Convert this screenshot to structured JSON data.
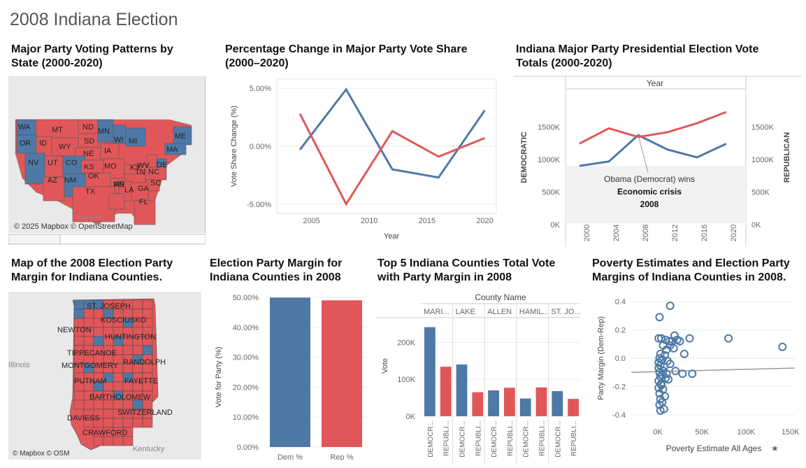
{
  "dashboard_title": "2008 Indiana Election",
  "colors": {
    "dem": "#4e79a7",
    "rep": "#e15759",
    "map_bg": "#e6e6e6",
    "trend": "#999999"
  },
  "panels": {
    "us_map": {
      "title_line1": "Major Party Voting Patterns by",
      "title_line2": "State (2000-2020)",
      "attribution": "© 2025 Mapbox © OpenStreetMap",
      "country_label": "Mexico",
      "states": [
        {
          "abbr": "WA",
          "party": "dem"
        },
        {
          "abbr": "OR",
          "party": "dem"
        },
        {
          "abbr": "MT",
          "party": "rep"
        },
        {
          "abbr": "ND",
          "party": "rep"
        },
        {
          "abbr": "MN",
          "party": "dem"
        },
        {
          "abbr": "ID",
          "party": "rep"
        },
        {
          "abbr": "SD",
          "party": "rep"
        },
        {
          "abbr": "WI",
          "party": "dem"
        },
        {
          "abbr": "MI",
          "party": "dem"
        },
        {
          "abbr": "WY",
          "party": "rep"
        },
        {
          "abbr": "NE",
          "party": "rep"
        },
        {
          "abbr": "IA",
          "party": "rep"
        },
        {
          "abbr": "NV",
          "party": "dem"
        },
        {
          "abbr": "UT",
          "party": "rep"
        },
        {
          "abbr": "CO",
          "party": "dem"
        },
        {
          "abbr": "MO",
          "party": "rep"
        },
        {
          "abbr": "KS",
          "party": "rep"
        },
        {
          "abbr": "KY",
          "party": "rep"
        },
        {
          "abbr": "WV",
          "party": "rep"
        },
        {
          "abbr": "DE",
          "party": "dem"
        },
        {
          "abbr": "AZ",
          "party": "rep"
        },
        {
          "abbr": "NM",
          "party": "dem"
        },
        {
          "abbr": "OK",
          "party": "rep"
        },
        {
          "abbr": "TN",
          "party": "rep"
        },
        {
          "abbr": "NC",
          "party": "rep"
        },
        {
          "abbr": "AR",
          "party": "rep"
        },
        {
          "abbr": "SC",
          "party": "rep"
        },
        {
          "abbr": "TX",
          "party": "rep"
        },
        {
          "abbr": "MS",
          "party": "rep"
        },
        {
          "abbr": "GA",
          "party": "rep"
        },
        {
          "abbr": "LA",
          "party": "rep"
        },
        {
          "abbr": "FL",
          "party": "rep"
        },
        {
          "abbr": "ME",
          "party": "dem"
        },
        {
          "abbr": "MA",
          "party": "dem"
        }
      ]
    },
    "pct_change": {
      "title_line1": "Percentage Change in Major Party Vote Share",
      "title_line2": "(2000–2020)"
    },
    "totals": {
      "title_line1": "Indiana Major Party Presidential Election Vote",
      "title_line2": "Totals (2000-2020)",
      "annotation_line1": "Obama (Democrat) wins",
      "annotation_line2": "Economic crisis",
      "annotation_line3": "2008"
    },
    "in_map": {
      "title_line1": "Map of the 2008 Election Party",
      "title_line2": "Margin for Indiana Counties.",
      "attribution": "© Mapbox © OSM",
      "region_labels": [
        "Illinois",
        "Kentucky"
      ],
      "county_labels": [
        "ST. JOSEPH",
        "KOSCIUSKO",
        "NEWTON",
        "HUNTINGTON",
        "TIPPECANOE",
        "MONTGOMERY",
        "RANDOLPH",
        "PUTNAM",
        "FAYETTE",
        "BARTHOLOMEW",
        "DAVIESS",
        "SWITZERLAND",
        "CRAWFORD"
      ]
    },
    "margin": {
      "title_line1": "Election Party Margin for",
      "title_line2": "Indiana Counties in 2008"
    },
    "top5": {
      "title_line1": "Top 5 Indiana Counties Total Vote",
      "title_line2": "with Party Margin in 2008"
    },
    "poverty": {
      "title_line1": "Poverty Estimates and Election Party",
      "title_line2": "Margins of Indiana Counties in 2008.",
      "pin_icon": "pin-icon"
    }
  },
  "chart_data": [
    {
      "type": "line",
      "x": [
        2004,
        2008,
        2012,
        2016,
        2020
      ],
      "series": [
        {
          "name": "Democratic",
          "values": [
            -0.3,
            4.9,
            -2.0,
            -2.7,
            3.1
          ]
        },
        {
          "name": "Republican",
          "values": [
            2.8,
            -5.0,
            1.3,
            -0.9,
            0.7
          ]
        }
      ],
      "xlabel": "Year",
      "ylabel": "Vote Share Change (%)",
      "xticks": [
        "2005",
        "2010",
        "2015",
        "2020"
      ],
      "yticks": [
        "5.00%",
        "0.00%",
        "-5.00%"
      ],
      "xlim": [
        2002,
        2021
      ],
      "ylim": [
        -5.8,
        5.8
      ]
    },
    {
      "type": "line",
      "x": [
        "2000",
        "2004",
        "2008",
        "2012",
        "2016",
        "2020"
      ],
      "series": [
        {
          "name": "DEMOCRATIC",
          "values": [
            902000,
            969000,
            1374000,
            1152000,
            1033000,
            1242000
          ]
        },
        {
          "name": "REPUBLICAN",
          "values": [
            1245000,
            1479000,
            1346000,
            1420000,
            1557000,
            1730000
          ]
        }
      ],
      "top_axis_label": "Year",
      "ylabel_left": "DEMOCRATIC",
      "ylabel_right": "REPUBLICAN",
      "yticks": [
        "1500K",
        "1000K",
        "500K",
        "0K"
      ],
      "ylim": [
        0,
        2000000
      ]
    },
    {
      "type": "bar",
      "categories": [
        "Dem %",
        "Rep %"
      ],
      "values": [
        49.9,
        49.0
      ],
      "ylabel": "Vote for Party (%)",
      "yticks": [
        "50.00%",
        "40.00%",
        "30.00%",
        "20.00%",
        "10.00%",
        "0.00%"
      ],
      "ylim": [
        0,
        50
      ]
    },
    {
      "type": "bar",
      "column_header": "County Name",
      "counties": [
        "MARI...",
        "LAKE",
        "ALLEN",
        "HAMIL...",
        "ST. JO..."
      ],
      "party_labels": [
        "DEMOCR...",
        "REPUBLI..."
      ],
      "series": [
        {
          "name": "DEMOCR...",
          "values": [
            241000,
            140000,
            70000,
            48000,
            68000
          ]
        },
        {
          "name": "REPUBLI...",
          "values": [
            134000,
            65000,
            77000,
            78000,
            47000
          ]
        }
      ],
      "ylabel": "Vote",
      "yticks": [
        "200K",
        "100K",
        "0K"
      ],
      "ylim": [
        0,
        265000
      ]
    },
    {
      "type": "scatter",
      "xlabel": "Poverty Estimate All Ages",
      "ylabel": "Party Margin (Dem-Rep)",
      "xticks": [
        "0K",
        "50K",
        "100K",
        "150K"
      ],
      "yticks": [
        "0.4",
        "0.2",
        "0.0",
        "-0.2",
        "-0.4"
      ],
      "xlim": [
        -30000,
        155000
      ],
      "ylim": [
        -0.45,
        0.45
      ],
      "trendline": {
        "x": [
          -30000,
          155000
        ],
        "y": [
          -0.1,
          -0.07
        ]
      },
      "points": [
        [
          14000,
          0.37
        ],
        [
          2000,
          0.29
        ],
        [
          1000,
          0.14
        ],
        [
          4000,
          0.14
        ],
        [
          9000,
          0.13
        ],
        [
          13000,
          0.12
        ],
        [
          16000,
          0.12
        ],
        [
          19000,
          0.16
        ],
        [
          22000,
          0.13
        ],
        [
          25000,
          0.12
        ],
        [
          36000,
          0.14
        ],
        [
          80000,
          0.14
        ],
        [
          141000,
          0.08
        ],
        [
          30000,
          0.03
        ],
        [
          14000,
          0.09
        ],
        [
          6000,
          0.09
        ],
        [
          10000,
          0.06
        ],
        [
          18000,
          0.07
        ],
        [
          3000,
          0.03
        ],
        [
          8000,
          0.02
        ],
        [
          2000,
          0.0
        ],
        [
          5000,
          -0.01
        ],
        [
          1000,
          -0.03
        ],
        [
          3000,
          -0.05
        ],
        [
          7000,
          -0.06
        ],
        [
          11000,
          -0.02
        ],
        [
          14000,
          -0.04
        ],
        [
          20000,
          -0.09
        ],
        [
          28000,
          -0.11
        ],
        [
          39000,
          -0.11
        ],
        [
          2000,
          -0.1
        ],
        [
          5000,
          -0.12
        ],
        [
          9000,
          -0.14
        ],
        [
          12000,
          -0.15
        ],
        [
          1000,
          -0.16
        ],
        [
          4000,
          -0.19
        ],
        [
          6000,
          -0.22
        ],
        [
          2000,
          -0.25
        ],
        [
          8000,
          -0.27
        ],
        [
          3000,
          -0.29
        ],
        [
          5000,
          -0.31
        ],
        [
          2000,
          -0.33
        ],
        [
          7000,
          -0.36
        ],
        [
          3000,
          -0.37
        ],
        [
          4000,
          -0.18
        ],
        [
          1000,
          -0.07
        ],
        [
          6000,
          -0.09
        ],
        [
          10000,
          -0.11
        ],
        [
          3000,
          -0.13
        ],
        [
          1000,
          -0.21
        ]
      ]
    }
  ]
}
